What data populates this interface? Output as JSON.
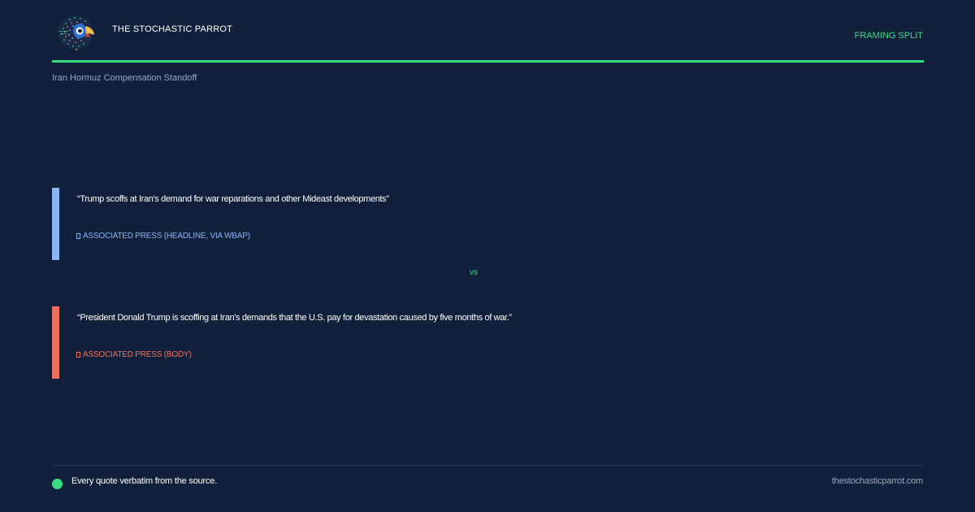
{
  "brand": {
    "name": "THE STOCHASTIC PARROT",
    "logo_icon": "parrot-logo-icon"
  },
  "header": {
    "section_tag": "FRAMING SPLIT",
    "topic": "Iran Hormuz Compensation Standoff"
  },
  "quotes": [
    {
      "text": "“Trump scoffs at Iran's demand for war reparations and other Mideast developments”",
      "source": "ASSOCIATED PRESS (HEADLINE, VIA WBAP)",
      "accent_color": "#8bb4f3"
    },
    {
      "text": "“President Donald Trump is scoffing at Iran's demands that the U.S. pay for devastation caused by five months of war.”",
      "source": "ASSOCIATED PRESS (BODY)",
      "accent_color": "#ee6f5f"
    }
  ],
  "divider": {
    "label": "vs"
  },
  "footer": {
    "note": "Every quote verbatim from the source.",
    "site": "thestochasticparrot.com"
  },
  "colors": {
    "background": "#12213b",
    "accent": "#3ddc84",
    "muted_text": "#9aa6bd"
  }
}
